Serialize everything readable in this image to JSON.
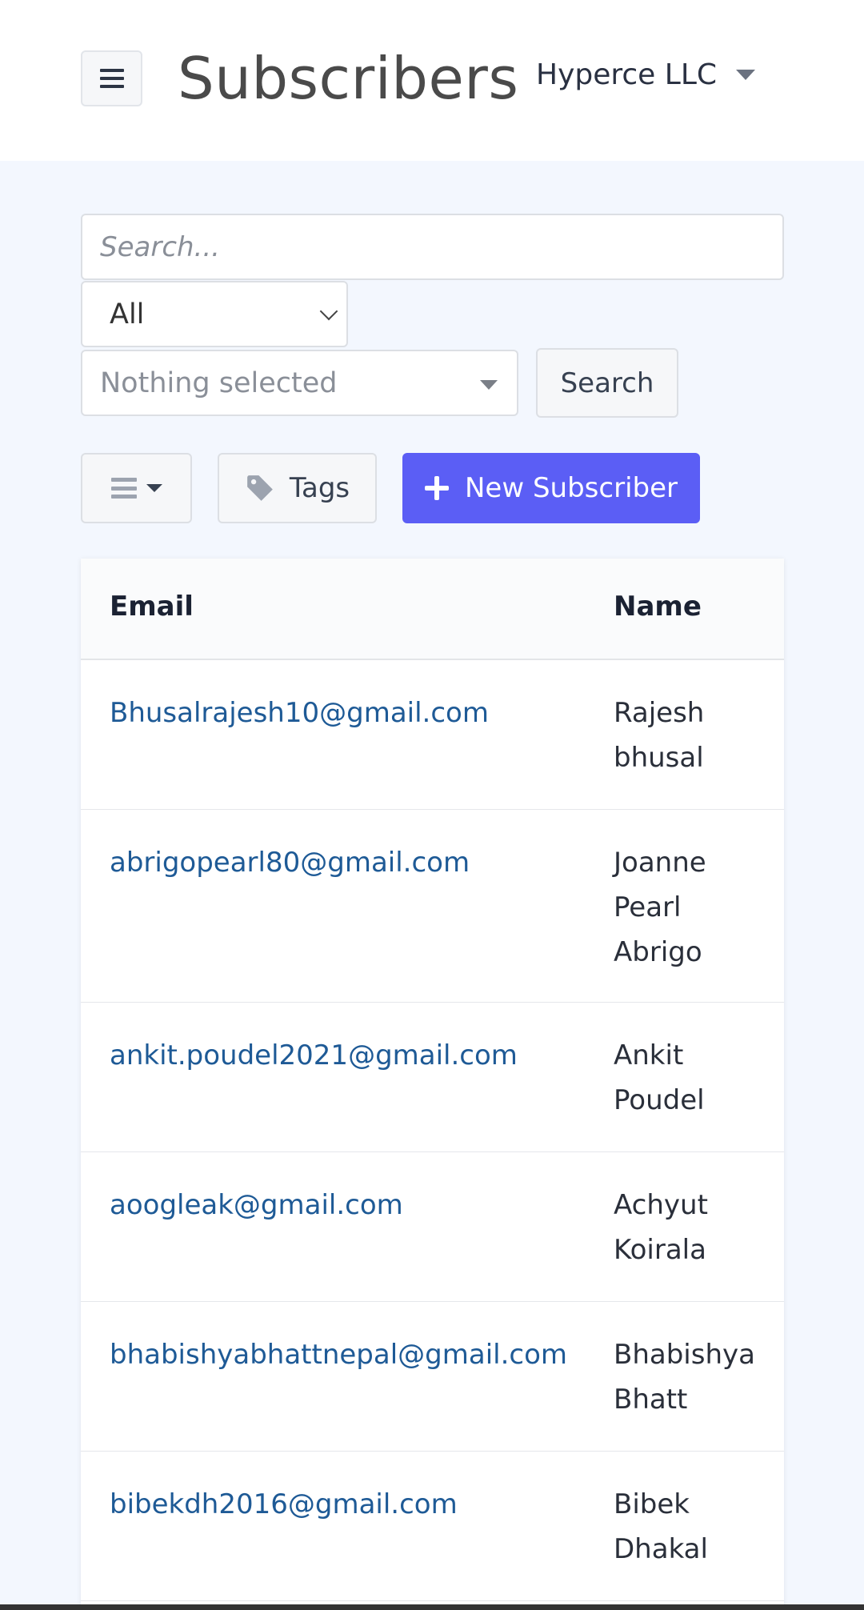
{
  "header": {
    "title": "Subscribers",
    "organization": "Hyperce LLC"
  },
  "filters": {
    "search_placeholder": "Search...",
    "status_value": "All",
    "tags_select_placeholder": "Nothing selected",
    "search_button": "Search"
  },
  "toolbar": {
    "tags_label": "Tags",
    "new_label": "New Subscriber"
  },
  "table": {
    "columns": [
      "Email",
      "Name"
    ],
    "rows": [
      {
        "email": "Bhusalrajesh10@gmail.com",
        "name": "Rajesh bhusal"
      },
      {
        "email": "abrigopearl80@gmail.com",
        "name": "Joanne Pearl Abrigo"
      },
      {
        "email": "ankit.poudel2021@gmail.com",
        "name": "Ankit Poudel"
      },
      {
        "email": "aoogleak@gmail.com",
        "name": "Achyut Koirala"
      },
      {
        "email": "bhabishyabhattnepal@gmail.com",
        "name": "Bhabishya Bhatt"
      },
      {
        "email": "bibekdh2016@gmail.com",
        "name": "Bibek Dhakal"
      }
    ]
  },
  "icons": {
    "menu": "hamburger-icon",
    "columns": "list-icon",
    "tag": "tag-icon",
    "add": "plus-icon"
  },
  "colors": {
    "primary": "#5b5ef5",
    "link": "#1e5a96",
    "background": "#f3f7fe"
  }
}
